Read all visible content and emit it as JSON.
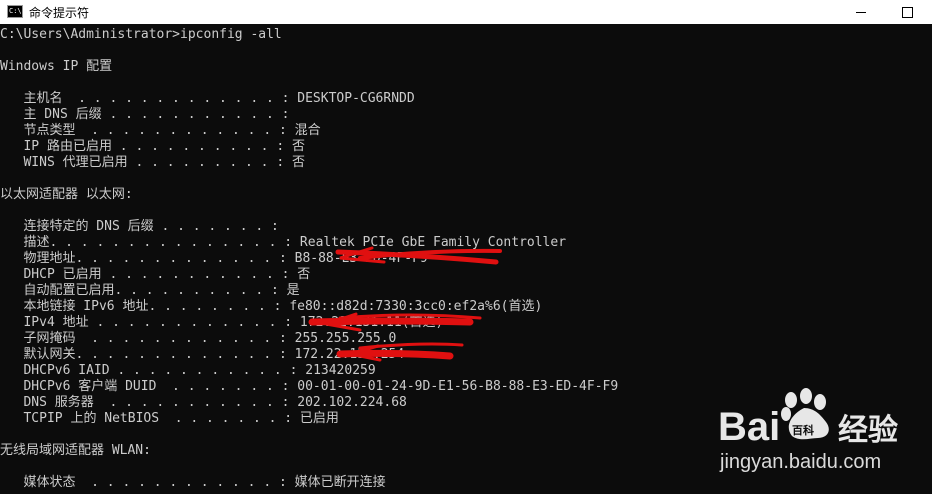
{
  "window": {
    "title": "命令提示符",
    "icon": "cmd-icon",
    "icon_glyph": "C:\\"
  },
  "console": {
    "lines": [
      "C:\\Users\\Administrator>ipconfig -all",
      "",
      "Windows IP 配置",
      "",
      "   主机名  . . . . . . . . . . . . . : DESKTOP-CG6RNDD",
      "   主 DNS 后缀 . . . . . . . . . . . :",
      "   节点类型  . . . . . . . . . . . . : 混合",
      "   IP 路由已启用 . . . . . . . . . . : 否",
      "   WINS 代理已启用 . . . . . . . . . : 否",
      "",
      "以太网适配器 以太网:",
      "",
      "   连接特定的 DNS 后缀 . . . . . . . :",
      "   描述. . . . . . . . . . . . . . . : Realtek PCIe GbE Family Controller",
      "   物理地址. . . . . . . . . . . . . : B8-88-E3-ED-4F-F9",
      "   DHCP 已启用 . . . . . . . . . . . : 否",
      "   自动配置已启用. . . . . . . . . . : 是",
      "   本地链接 IPv6 地址. . . . . . . . : fe80::d82d:7330:3cc0:ef2a%6(首选)",
      "   IPv4 地址 . . . . . . . . . . . . : 172.22.131.11(首选)",
      "   子网掩码  . . . . . . . . . . . . : 255.255.255.0",
      "   默认网关. . . . . . . . . . . . . : 172.22.131.254",
      "   DHCPv6 IAID . . . . . . . . . . . : 213420259",
      "   DHCPv6 客户端 DUID  . . . . . . . : 00-01-00-01-24-9D-E1-56-B8-88-E3-ED-4F-F9",
      "   DNS 服务器  . . . . . . . . . . . : 202.102.224.68",
      "   TCPIP 上的 NetBIOS  . . . . . . . : 已启用",
      "",
      "无线局域网适配器 WLAN:",
      "",
      "   媒体状态  . . . . . . . . . . . . : 媒体已断开连接"
    ]
  },
  "annotation_color": "#e01010",
  "watermark": {
    "brand_left": "Bai",
    "brand_right": "百科",
    "brand_cn": "经验",
    "url": "jingyan.baidu.com",
    "icon": "baidu-paw-icon"
  }
}
